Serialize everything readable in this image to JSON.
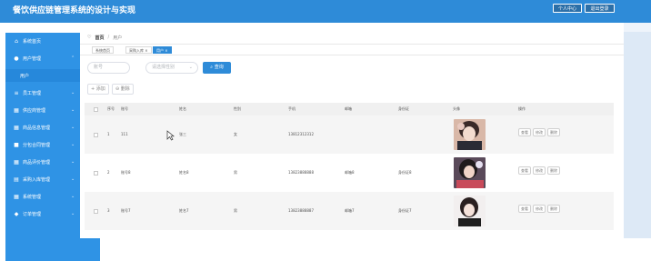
{
  "app": {
    "title": "餐饮供应链管理系统的设计与实现",
    "personal_center": "个人中心",
    "logout": "退出登录"
  },
  "sidebar": {
    "items": [
      {
        "label": "系统首页",
        "icon": "home-icon"
      },
      {
        "label": "用户管理",
        "icon": "user-icon"
      },
      {
        "label": "用户",
        "icon": ""
      },
      {
        "label": "员工管理",
        "icon": "list-icon"
      },
      {
        "label": "供应商管理",
        "icon": "grid-icon"
      },
      {
        "label": "商品信息管理",
        "icon": "grid-icon"
      },
      {
        "label": "分包合同管理",
        "icon": "briefcase-icon"
      },
      {
        "label": "商品评价管理",
        "icon": "grid-icon"
      },
      {
        "label": "采购入库管理",
        "icon": "truck-icon"
      },
      {
        "label": "系统管理",
        "icon": "grid-icon"
      },
      {
        "label": "订单管理",
        "icon": "cart-icon"
      }
    ]
  },
  "breadcrumb": {
    "home": "首页",
    "current": "用户"
  },
  "tabs": [
    {
      "label": "系统首页"
    },
    {
      "label": "采购入库 ×"
    },
    {
      "label": "用户 ×",
      "active": true
    }
  ],
  "search": {
    "account_placeholder": "账号",
    "category_placeholder": "请选择性别",
    "query_label": "查询",
    "add_label": "+ 添加",
    "delete_label": "删除"
  },
  "table": {
    "headers": [
      "",
      "序号",
      "账号",
      "姓名",
      "性别",
      "手机",
      "邮箱",
      "身份证",
      "头像",
      "操作"
    ],
    "rows": [
      {
        "index": "1",
        "account": "111",
        "name": "张三",
        "gender": "女",
        "phone": "13812312312",
        "email": "",
        "id_card": ""
      },
      {
        "index": "2",
        "account": "账号8",
        "name": "姓名8",
        "gender": "男",
        "phone": "13823888888",
        "email": "邮箱8",
        "id_card": "身份证8"
      },
      {
        "index": "3",
        "account": "账号7",
        "name": "姓名7",
        "gender": "男",
        "phone": "13823888887",
        "email": "邮箱7",
        "id_card": "身份证7"
      }
    ],
    "actions": [
      "查看",
      "修改",
      "删除"
    ]
  },
  "colors": {
    "topbar": "#2e8bd8",
    "sidebar": "#2f93e5",
    "accent": "#2e8bd8"
  }
}
